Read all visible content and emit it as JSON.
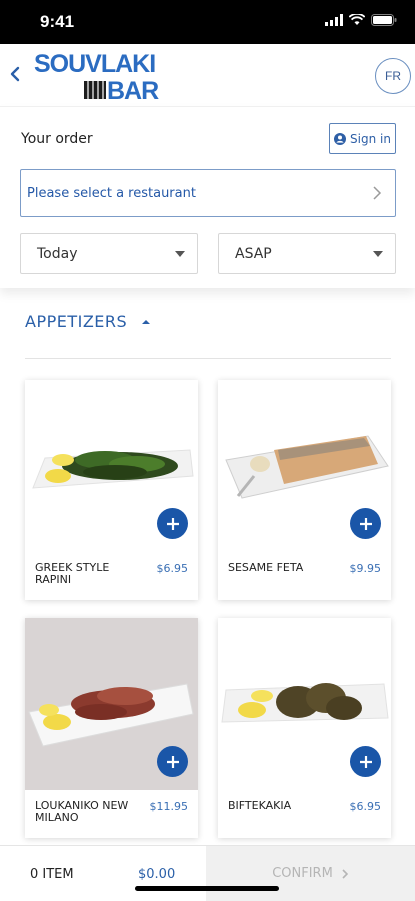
{
  "status": {
    "time": "9:41"
  },
  "header": {
    "logo_line1": "SOUVLAKI",
    "logo_line2": "BAR",
    "language": "FR",
    "brand_color": "#2b6cc1"
  },
  "order": {
    "title": "Your order",
    "signin_label": "Sign in",
    "restaurant_placeholder": "Please select a restaurant",
    "day": "Today",
    "time": "ASAP"
  },
  "menu": {
    "category": "APPETIZERS",
    "items": [
      {
        "name": "GREEK STYLE RAPINI",
        "price": "$6.95"
      },
      {
        "name": "SESAME FETA",
        "price": "$9.95"
      },
      {
        "name": "LOUKANIKO NEW MILANO",
        "price": "$11.95"
      },
      {
        "name": "BIFTEKAKIA",
        "price": "$6.95"
      }
    ]
  },
  "cart": {
    "items_label": "0 ITEM",
    "total": "$0.00",
    "confirm_label": "CONFIRM"
  }
}
